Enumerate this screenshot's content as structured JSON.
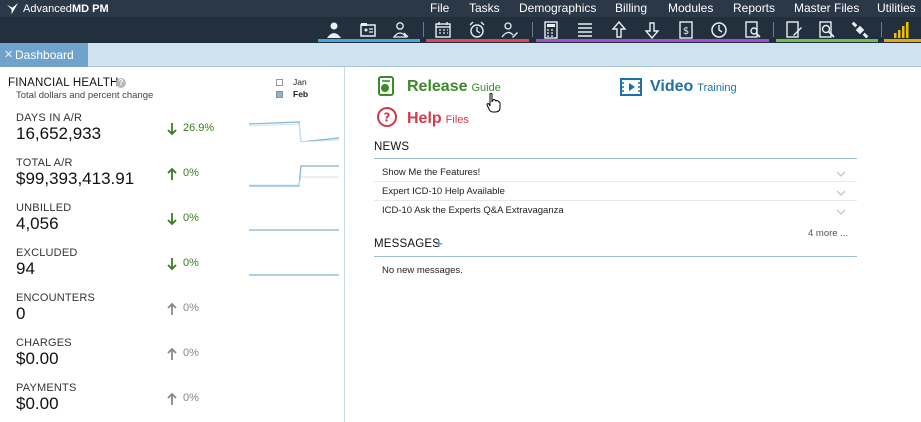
{
  "app": {
    "name_light": "Advanced",
    "name_bold": "MD PM"
  },
  "menu": [
    "File",
    "Tasks",
    "Demographics",
    "Billing",
    "Modules",
    "Reports",
    "Master Files",
    "Utilities"
  ],
  "toolbar": {
    "icons": [
      "patient-icon",
      "folder-card-icon",
      "user-outline-icon",
      "calendar-icon",
      "alarm-clock-icon",
      "user-edit-icon",
      "calculator-icon",
      "list-icon",
      "upload-arrow-icon",
      "download-arrow-icon",
      "dollar-document-icon",
      "clock-icon",
      "document-search-icon",
      "document-edit-icon",
      "magnify-document-icon",
      "satellite-icon",
      "signal-bars-icon"
    ],
    "group_colors": [
      "#4aa3df",
      "#e0435a",
      "#9e4fc9",
      "#6bbf4a",
      "#f0a400"
    ]
  },
  "tabs": [
    {
      "label": "Dashboard",
      "close": "✕"
    }
  ],
  "financial_health": {
    "title": "FINANCIAL HEALTH",
    "help": "?",
    "subtitle": "Total dollars and percent change",
    "legend": [
      "Jan",
      "Feb"
    ],
    "metrics": [
      {
        "label": "DAYS IN A/R",
        "value": "16,652,933",
        "change": "26.9%",
        "direction": "down",
        "color": "#3a7d1e"
      },
      {
        "label": "TOTAL A/R",
        "value": "$99,393,413.91",
        "change": "0%",
        "direction": "up",
        "color": "#3a7d1e"
      },
      {
        "label": "UNBILLED",
        "value": "4,056",
        "change": "0%",
        "direction": "down",
        "color": "#3a7d1e"
      },
      {
        "label": "EXCLUDED",
        "value": "94",
        "change": "0%",
        "direction": "down",
        "color": "#3a7d1e"
      },
      {
        "label": "ENCOUNTERS",
        "value": "0",
        "change": "0%",
        "direction": "up",
        "color": "#888888"
      },
      {
        "label": "CHARGES",
        "value": "$0.00",
        "change": "0%",
        "direction": "up",
        "color": "#888888"
      },
      {
        "label": "PAYMENTS",
        "value": "$0.00",
        "change": "0%",
        "direction": "up",
        "color": "#888888"
      }
    ]
  },
  "quick_links": {
    "release": {
      "main": "Release",
      "sub": "Guide",
      "color": "#3c8a2a"
    },
    "video": {
      "main": "Video",
      "sub": "Training",
      "color": "#1f6fa8"
    },
    "help": {
      "main": "Help",
      "sub": "Files",
      "color": "#d63a4a"
    }
  },
  "news": {
    "title": "NEWS",
    "items": [
      "Show Me the Features!",
      "Expert ICD-10 Help Available",
      "ICD-10 Ask the Experts Q&A Extravaganza"
    ],
    "more": "4 more ..."
  },
  "messages": {
    "title": "MESSAGES",
    "add": "+",
    "empty": "No new messages."
  }
}
